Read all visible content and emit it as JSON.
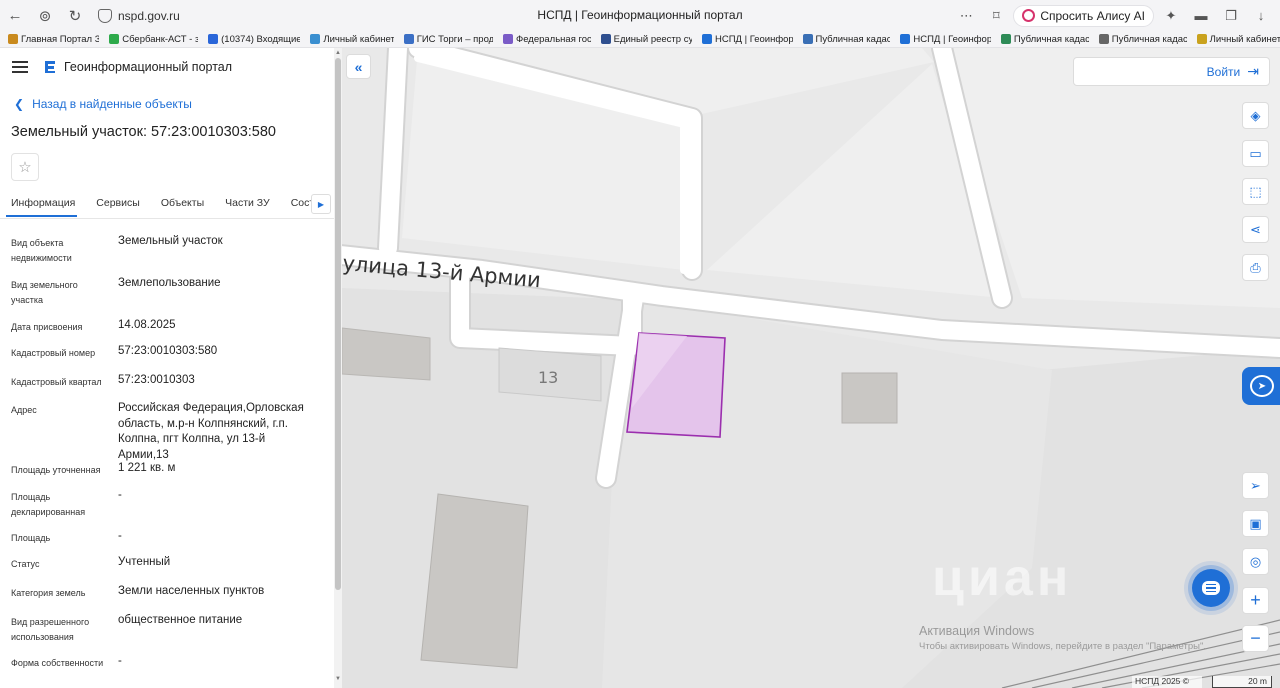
{
  "browser": {
    "url": "nspd.gov.ru",
    "tab_title": "НСПД | Геоинформационный портал",
    "alice_label": "Спросить Алису AI",
    "bookmarks": [
      {
        "label": "Главная Портал З",
        "color": "#c98a1e"
      },
      {
        "label": "Сбербанк-АСТ - з",
        "color": "#2eaa4b"
      },
      {
        "label": "(10374) Входящие",
        "color": "#2a66d9"
      },
      {
        "label": "Личный кабинет",
        "color": "#3a8fd0"
      },
      {
        "label": "ГИС Торги – прод",
        "color": "#3b6fc5"
      },
      {
        "label": "Федеральная гос",
        "color": "#7a5bc7"
      },
      {
        "label": "Единый реестр су",
        "color": "#2f4f8f"
      },
      {
        "label": "НСПД | Геоинфор",
        "color": "#1f6fd6"
      },
      {
        "label": "Публичная кадас",
        "color": "#3a6fb5"
      },
      {
        "label": "НСПД | Геоинфор",
        "color": "#1f6fd6"
      },
      {
        "label": "Публичная кадас",
        "color": "#2e8b57"
      },
      {
        "label": "Публичная кадас",
        "color": "#666666"
      },
      {
        "label": "Личный кабинет",
        "color": "#c9a21e"
      }
    ]
  },
  "panel": {
    "portal_name": "Геоинформационный портал",
    "back_label": "Назад в найденные объекты",
    "title": "Земельный участок: 57:23:0010303:580",
    "tabs": [
      "Информация",
      "Сервисы",
      "Объекты",
      "Части ЗУ",
      "Соста"
    ],
    "properties": [
      {
        "label": "Вид объекта недвижимости",
        "value": "Земельный участок"
      },
      {
        "label": "Вид земельного участка",
        "value": "Землепользование"
      },
      {
        "label": "Дата присвоения",
        "value": "14.08.2025"
      },
      {
        "label": "Кадастровый номер",
        "value": "57:23:0010303:580"
      },
      {
        "label": "Кадастровый квартал",
        "value": "57:23:0010303"
      },
      {
        "label": "Адрес",
        "value": "Российская Федерация,Орловская область, м.р-н Колпнянский, г.п. Колпна, пгт Колпна, ул 13-й Армии,13"
      },
      {
        "label": "Площадь уточненная",
        "value": "1 221 кв. м"
      },
      {
        "label": "Площадь декларированная",
        "value": "-"
      },
      {
        "label": "Площадь",
        "value": "-"
      },
      {
        "label": "Статус",
        "value": "Учтенный"
      },
      {
        "label": "Категория земель",
        "value": "Земли населенных пунктов"
      },
      {
        "label": "Вид разрешенного использования",
        "value": "общественное питание"
      },
      {
        "label": "Форма собственности",
        "value": "-"
      }
    ]
  },
  "map": {
    "street_label": "улица 13-й Армии",
    "house_number": "13",
    "login_label": "Войти",
    "watermark": "циан",
    "activation_title": "Активация Windows",
    "activation_sub": "Чтобы активировать Windows, перейдите в раздел \"Параметры\".",
    "copyright": "НСПД 2025 ©",
    "scale": "20 m",
    "parcel_color": "#9b2fae",
    "accent_color": "#1f6fd6"
  }
}
